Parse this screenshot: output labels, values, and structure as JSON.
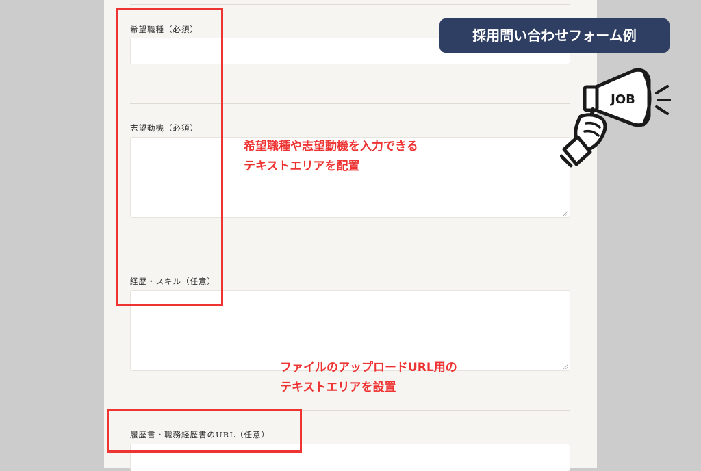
{
  "badge": {
    "title": "採用問い合わせフォーム例"
  },
  "illustration": {
    "sign_text": "JOB"
  },
  "form": {
    "fields": [
      {
        "label": "希望職種（必須）",
        "type": "text"
      },
      {
        "label": "志望動機（必須）",
        "type": "textarea"
      },
      {
        "label": "経歴・スキル（任意）",
        "type": "textarea"
      },
      {
        "label": "履歴書・職務経歴書のURL（任意）",
        "type": "text"
      }
    ]
  },
  "annotations": {
    "textarea_note": {
      "line1": "希望職種や志望動機を入力できる",
      "line2": "テキストエリアを配置"
    },
    "url_note": {
      "line1": "ファイルのアップロードURL用の",
      "line2": "テキストエリアを設置"
    }
  },
  "colors": {
    "highlight": "#ee3333",
    "badge_background": "#2f3f63",
    "page_background": "#f6f5f1",
    "outer_background": "#cccccc"
  }
}
